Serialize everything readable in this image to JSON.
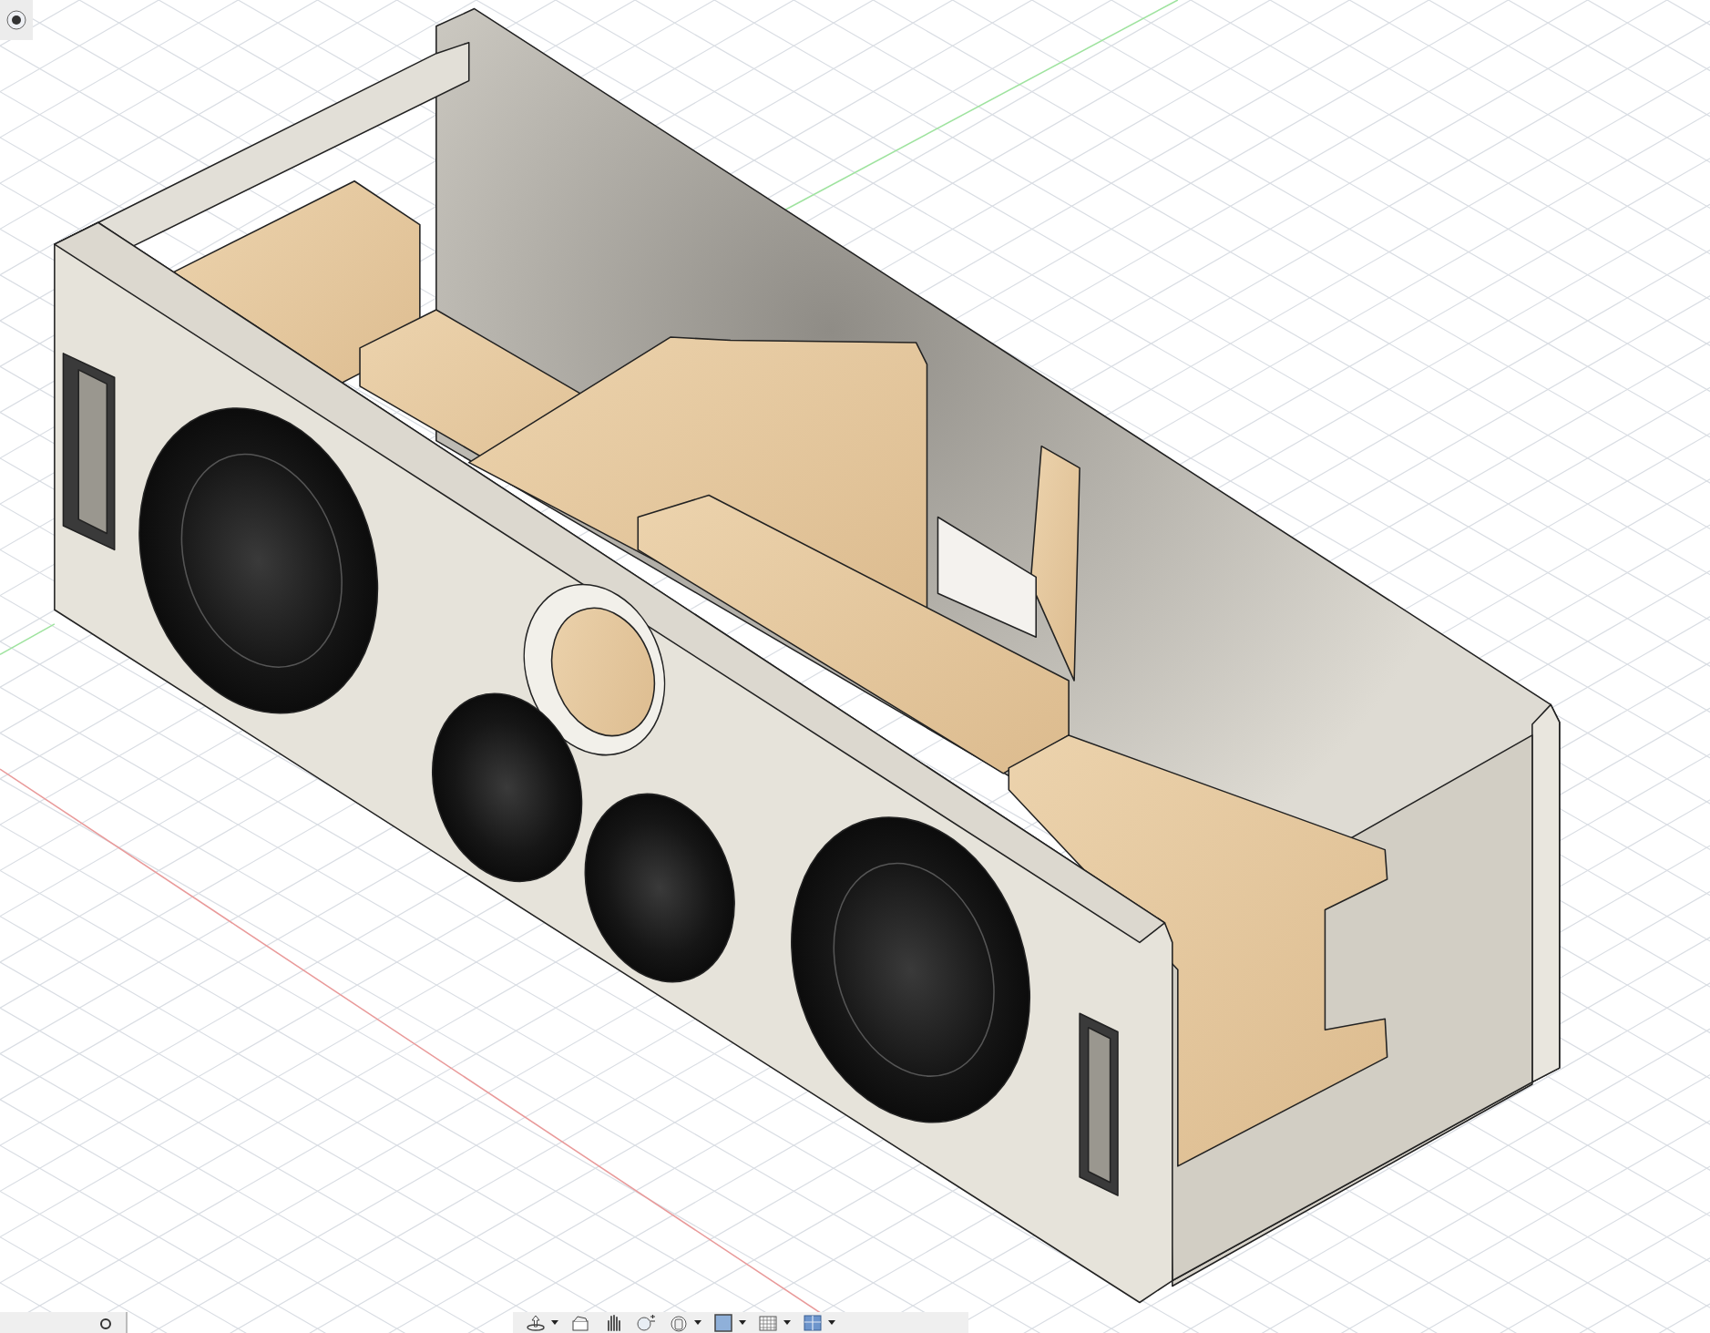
{
  "toolbar": {
    "items": [
      {
        "kind": "orbit",
        "dropdown": true
      },
      {
        "kind": "look_at",
        "dropdown": false
      },
      {
        "kind": "pan",
        "dropdown": false
      },
      {
        "kind": "zoom",
        "dropdown": false
      },
      {
        "kind": "fit",
        "dropdown": true
      },
      {
        "kind": "display",
        "dropdown": true
      },
      {
        "kind": "grid",
        "dropdown": true
      },
      {
        "kind": "viewports",
        "dropdown": true
      }
    ]
  }
}
